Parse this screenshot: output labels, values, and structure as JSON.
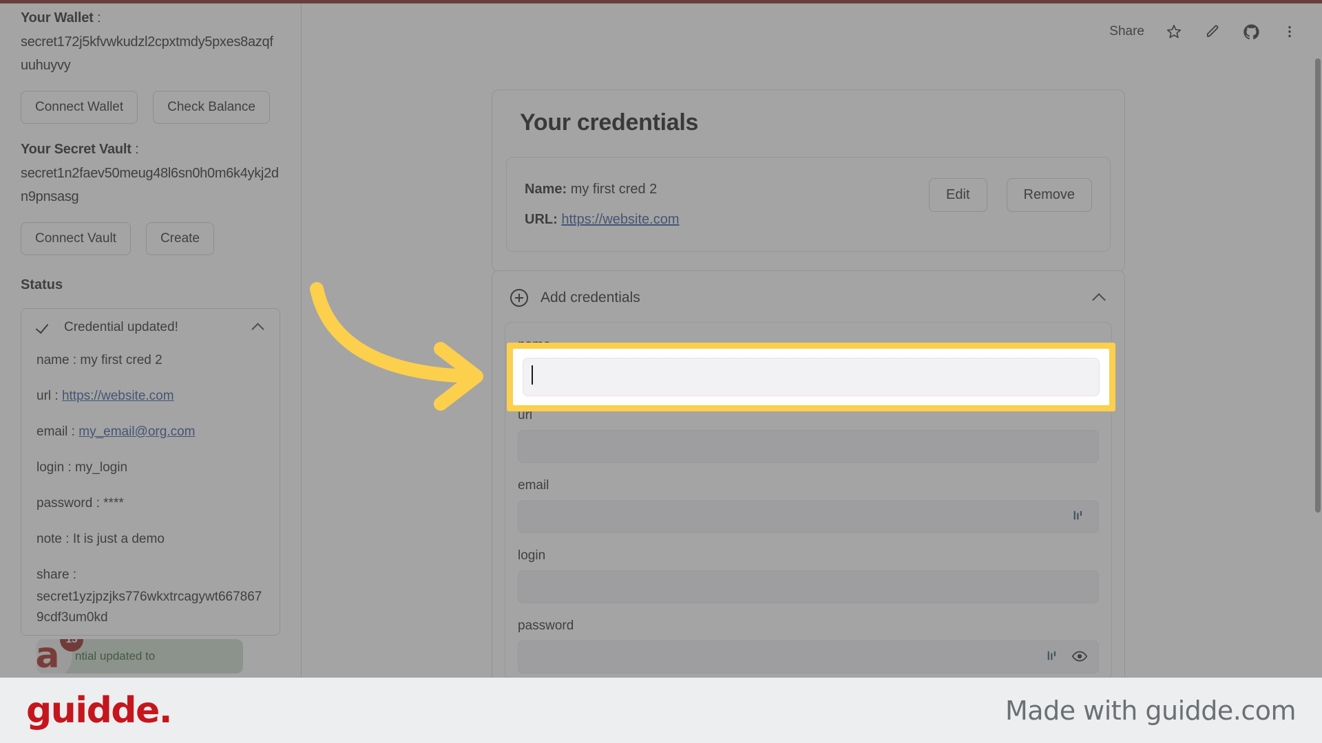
{
  "footer": {
    "logo": "guidde.",
    "made_with": "Made with guidde.com"
  },
  "toolbar": {
    "share_label": "Share",
    "icons": [
      "star-icon",
      "pencil-icon",
      "github-icon",
      "more-vertical-icon"
    ]
  },
  "sidebar": {
    "wallet_heading": "Your Wallet",
    "wallet_address": "secret172j5kfvwkudzl2cpxtmdy5pxes8azqfuuhuyvy",
    "wallet_buttons": [
      "Connect Wallet",
      "Check Balance"
    ],
    "vault_heading": "Your Secret Vault",
    "vault_address": "secret1n2faev50meug48l6sn0h0m6k4ykj2dn9pnsasg",
    "vault_buttons": [
      "Connect Vault",
      "Create"
    ],
    "status_heading": "Status",
    "status": {
      "title": "Credential updated!",
      "fields": [
        {
          "key": "name : ",
          "value": "my first cred 2",
          "link": false
        },
        {
          "key": "url : ",
          "value": "https://website.com",
          "link": true
        },
        {
          "key": "email : ",
          "value": "my_email@org.com",
          "link": true
        },
        {
          "key": "login : ",
          "value": "my_login",
          "link": false
        },
        {
          "key": "password : ",
          "value": "****",
          "link": false
        },
        {
          "key": "note : ",
          "value": "It is just a demo",
          "link": false
        }
      ],
      "share_key": "share :",
      "share_value": "secret1yzjpzjks776wkxtrcagywt6678679cdf3um0kd"
    },
    "toast": {
      "avatar_letter": "a",
      "badge": "15",
      "text": "ntial updated to"
    }
  },
  "main": {
    "credentials_card": {
      "title": "Your credentials",
      "name_label": "Name:",
      "name_value": "my first cred 2",
      "url_label": "URL:",
      "url_value": "https://website.com",
      "edit_label": "Edit",
      "remove_label": "Remove"
    },
    "add_card": {
      "header_label": "Add credentials",
      "fields": [
        {
          "label": "name",
          "value": "",
          "highlighted": true
        },
        {
          "label": "url",
          "value": "",
          "highlighted": false
        },
        {
          "label": "email",
          "value": "",
          "highlighted": false
        },
        {
          "label": "login",
          "value": "",
          "highlighted": false
        },
        {
          "label": "password",
          "value": "",
          "highlighted": false
        }
      ]
    }
  },
  "annotation": {
    "arrow_color": "#fccf4d",
    "highlight_color": "#fccf4d"
  }
}
